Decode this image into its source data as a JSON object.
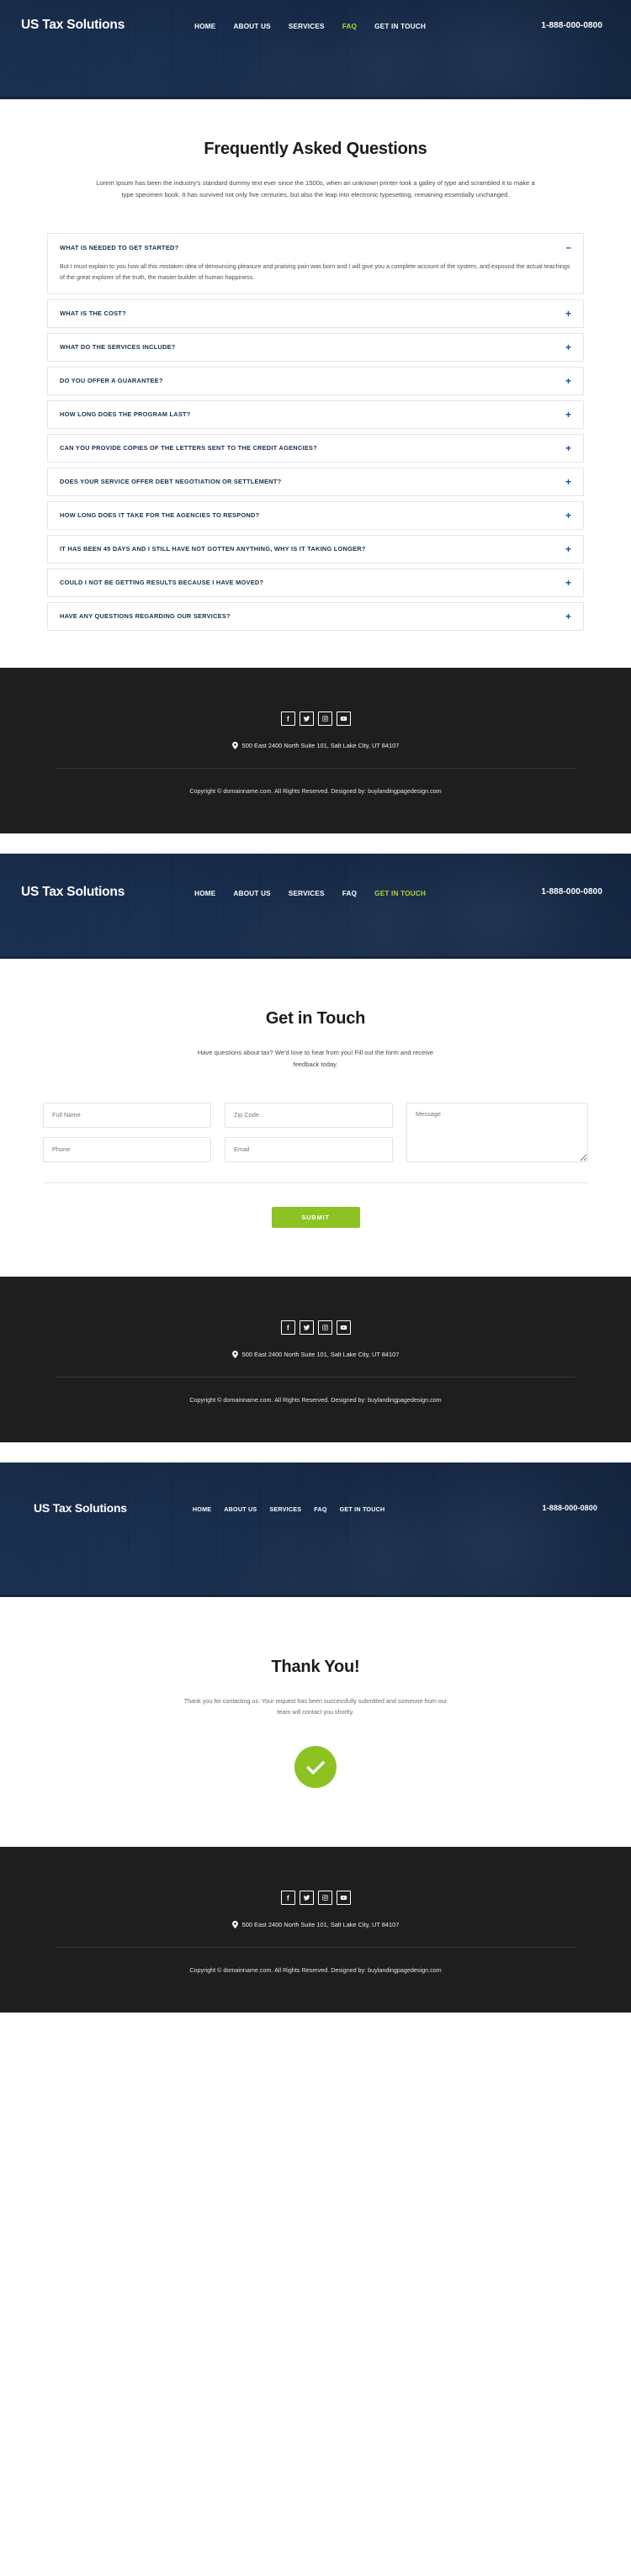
{
  "brand": {
    "name": "US Tax Solutions"
  },
  "nav": {
    "phone": "1-888-000-0800",
    "items_faq": [
      {
        "label": "HOME",
        "active": false
      },
      {
        "label": "ABOUT US",
        "active": false
      },
      {
        "label": "SERVICES",
        "active": false
      },
      {
        "label": "FAQ",
        "active": true
      },
      {
        "label": "GET IN TOUCH",
        "active": false
      }
    ],
    "items_contact": [
      {
        "label": "HOME",
        "active": false
      },
      {
        "label": "ABOUT US",
        "active": false
      },
      {
        "label": "SERVICES",
        "active": false
      },
      {
        "label": "FAQ",
        "active": false
      },
      {
        "label": "GET IN TOUCH",
        "active": true
      }
    ],
    "items_thanks": [
      {
        "label": "HOME",
        "active": false
      },
      {
        "label": "ABOUT US",
        "active": false
      },
      {
        "label": "SERVICES",
        "active": false
      },
      {
        "label": "FAQ",
        "active": false
      },
      {
        "label": "GET IN TOUCH",
        "active": false
      }
    ]
  },
  "faq": {
    "title": "Frequently Asked Questions",
    "intro": "Lorem Ipsum has been the industry's standard dummy text ever since the 1500s, when an unknown printer took a galley of type and scrambled it to make a type specimen book. It has survived not only five centuries, but also the leap into electronic typesetting, remaining essentially unchanged.",
    "expand_sign": "+",
    "collapse_sign": "–",
    "items": [
      {
        "question": "WHAT IS NEEDED TO GET STARTED?",
        "answer": "But I must explain to you how all this mistaken idea of denouncing pleasure and praising pain was born and I will give you a complete account of the system, and expound the actual teachings of the great explorer of the truth, the master-builder of human happiness.",
        "open": true
      },
      {
        "question": "WHAT IS THE COST?",
        "answer": "",
        "open": false
      },
      {
        "question": "WHAT DO THE SERVICES INCLUDE?",
        "answer": "",
        "open": false
      },
      {
        "question": "DO YOU OFFER A GUARANTEE?",
        "answer": "",
        "open": false
      },
      {
        "question": "HOW LONG DOES THE PROGRAM LAST?",
        "answer": "",
        "open": false
      },
      {
        "question": "CAN YOU PROVIDE COPIES OF THE LETTERS SENT TO THE CREDIT AGENCIES?",
        "answer": "",
        "open": false
      },
      {
        "question": "DOES YOUR SERVICE OFFER DEBT NEGOTIATION OR SETTLEMENT?",
        "answer": "",
        "open": false
      },
      {
        "question": "HOW LONG DOES IT TAKE FOR THE AGENCIES TO RESPOND?",
        "answer": "",
        "open": false
      },
      {
        "question": "IT HAS BEEN 45 DAYS AND I STILL HAVE NOT GOTTEN ANYTHING, WHY IS IT TAKING LONGER?",
        "answer": "",
        "open": false
      },
      {
        "question": "COULD I NOT BE GETTING RESULTS BECAUSE I HAVE MOVED?",
        "answer": "",
        "open": false
      },
      {
        "question": "HAVE ANY QUESTIONS REGARDING OUR SERVICES?",
        "answer": "",
        "open": false
      }
    ]
  },
  "contact": {
    "title": "Get in Touch",
    "intro": "Have questions about tax? We'd love to hear from you! Fill out the form and receive feedback today.",
    "fields": {
      "full_name": "Full Name",
      "zip_code": "Zip Code",
      "phone": "Phone",
      "email": "Email",
      "message": "Message"
    },
    "submit_label": "SUBMIT"
  },
  "thanks": {
    "title": "Thank You!",
    "message": "Thank you for contacting us. Your request has been successfully submitted and someone from our team will contact you shortly."
  },
  "footer": {
    "address": "500 East 2400 North Suite 101, Salt Lake City, UT 84107",
    "copyright": "Copyright © domainname.com. All Rights Reserved. Designed by: buylandingpagedesign.com",
    "social": [
      {
        "name": "facebook"
      },
      {
        "name": "twitter"
      },
      {
        "name": "instagram"
      },
      {
        "name": "youtube"
      }
    ]
  },
  "colors": {
    "accent_green": "#8cc323",
    "nav_active": "#b5d334",
    "footer_bg": "#1e1e1e",
    "heading": "#16304f",
    "plus_blue": "#1b4f9c"
  }
}
